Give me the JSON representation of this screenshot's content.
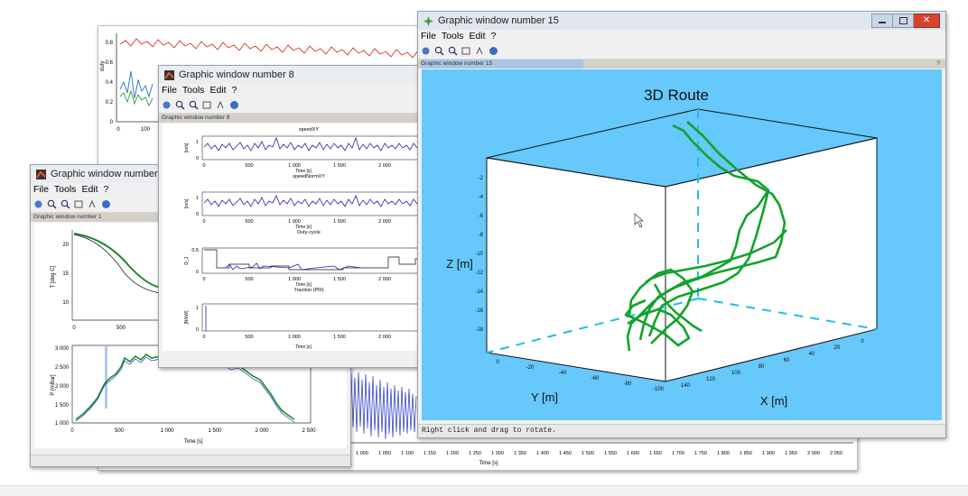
{
  "background_window": {
    "ylabel": "duty",
    "ticks_y": [
      "0.8",
      "0.6",
      "0.4",
      "0.2",
      "0"
    ],
    "ticks_x_top": [
      "0",
      "100"
    ],
    "bottom_ticks": [
      "1 000",
      "1 050",
      "1 100",
      "1 150",
      "1 200",
      "1 250",
      "1 300",
      "1 350",
      "1 400",
      "1 450",
      "1 500",
      "1 550",
      "1 600",
      "1 650",
      "1 700",
      "1 750",
      "1 800",
      "1 850",
      "1 900",
      "1 950",
      "2 000",
      "2 050"
    ],
    "bottom_xlabel": "Time [s]"
  },
  "window1": {
    "title": "Graphic window number 1",
    "menu": [
      "File",
      "Tools",
      "Edit",
      "?"
    ],
    "info": "Graphic window number 1",
    "top_plot": {
      "ticks_y": [
        "20",
        "15",
        "10"
      ],
      "ticks_x": [
        "0",
        "500"
      ],
      "ylabel": "T [deg C]"
    },
    "bottom_plot": {
      "ticks_y": [
        "3 000",
        "2 500",
        "2 000",
        "1 500",
        "1 000"
      ],
      "ticks_x": [
        "0",
        "500",
        "1 000",
        "1 500",
        "2 000",
        "2 500"
      ],
      "ylabel": "P [mBar]",
      "xlabel": "Time [s]"
    }
  },
  "window8": {
    "title": "Graphic window number 8",
    "menu": [
      "File",
      "Tools",
      "Edit",
      "?"
    ],
    "info": "Graphic window number 8",
    "plots": [
      {
        "title": "speedXY",
        "ylabel": "[m/s]",
        "ticks_y": [
          "1",
          "0"
        ],
        "xlabel": "Time [s]"
      },
      {
        "title": "speedNormXY",
        "ylabel": "[m/s]",
        "ticks_y": [
          "1",
          "0"
        ],
        "xlabel": "Time [s]"
      },
      {
        "title": "Duty-cycle",
        "ylabel": "D_1",
        "ticks_y": [
          "0.5",
          "0"
        ],
        "xlabel": "Time [s]"
      },
      {
        "title": "Traction (P0I)",
        "ylabel": "[N/kW]",
        "ticks_y": [
          "1",
          "0"
        ],
        "xlabel": "Time [s]"
      }
    ],
    "ticks_x": [
      "0",
      "500",
      "1 000",
      "1 500",
      "2 000"
    ]
  },
  "window15": {
    "title": "Graphic window number 15",
    "menu": [
      "File",
      "Tools",
      "Edit",
      "?"
    ],
    "info": "Graphic window number 15",
    "info_help": "?",
    "status": "Right click and drag to rotate.",
    "chart_title": "3D Route",
    "zlabel": "Z [m]",
    "ylabel": "Y [m]",
    "xlabel": "X [m]",
    "z_ticks": [
      "-2",
      "-4",
      "-6",
      "-8",
      "-10",
      "-12",
      "-14",
      "-16",
      "-18"
    ],
    "y_ticks": [
      "0",
      "-20",
      "-40",
      "-60",
      "-80",
      "-100"
    ],
    "x_ticks": [
      "140",
      "120",
      "100",
      "80",
      "60",
      "40",
      "20",
      "0"
    ],
    "colors": {
      "background": "#66c8fb",
      "route": "#11a32a",
      "axis_dash": "#1ac0e8"
    }
  }
}
